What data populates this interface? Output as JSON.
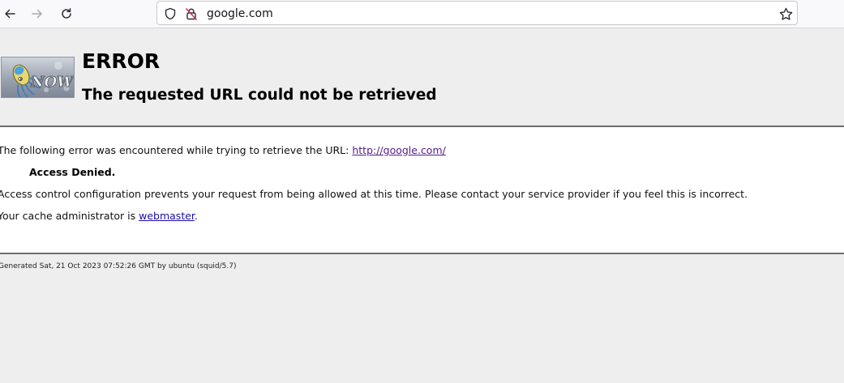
{
  "browser": {
    "url": "google.com",
    "icons": {
      "back": "arrow-left-icon",
      "forward": "arrow-right-icon",
      "reload": "reload-icon",
      "tracking": "shield-icon",
      "insecure": "insecure-lock-icon",
      "bookmark": "star-icon"
    }
  },
  "page": {
    "title": "ERROR",
    "subtitle": "The requested URL could not be retrieved",
    "logo_text": "NOW",
    "intro_text": "The following error was encountered while trying to retrieve the URL: ",
    "error_url": "http://google.com/",
    "error_name": "Access Denied.",
    "description": "Access control configuration prevents your request from being allowed at this time. Please contact your service provider if you feel this is incorrect.",
    "admin_prefix": "Your cache administrator is ",
    "admin_link": "webmaster",
    "admin_suffix": ".",
    "footer": "Generated Sat, 21 Oct 2023 07:52:26 GMT by ubuntu (squid/5.7)"
  },
  "colors": {
    "link": "#1a0dab",
    "visited_link": "#551a8b",
    "page_background": "#eeeeee",
    "content_background": "#ffffff"
  }
}
